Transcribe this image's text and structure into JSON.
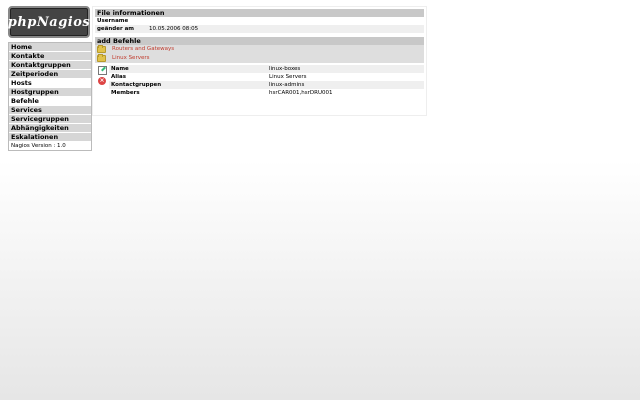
{
  "logo": {
    "text": "phpNagios"
  },
  "nav": {
    "items": [
      {
        "label": "Home"
      },
      {
        "label": "Kontakte"
      },
      {
        "label": "Kontaktgruppen"
      },
      {
        "label": "Zeitperioden"
      },
      {
        "label": "Hosts"
      },
      {
        "label": "Hostgruppen"
      },
      {
        "label": "Befehle"
      },
      {
        "label": "Services"
      },
      {
        "label": "Servicegruppen"
      },
      {
        "label": "Abhängigkeiten"
      },
      {
        "label": "Eskalationen"
      }
    ],
    "version": "Nagios Version : 1.0"
  },
  "file_info": {
    "header": "File informationen",
    "rows": [
      {
        "key": "Username",
        "value": ""
      },
      {
        "key": "geänder am",
        "value": "10.05.2006 08:05"
      }
    ]
  },
  "add": {
    "header": "add Befehle",
    "items": [
      {
        "label": "Routers and Gateways"
      },
      {
        "label": "Linux Servers"
      }
    ]
  },
  "details": {
    "rows": [
      {
        "key": "Name",
        "value": "linux-boxes"
      },
      {
        "key": "Alias",
        "value": "Linux Servers"
      },
      {
        "key": "Kontactgruppen",
        "value": "linux-admins"
      },
      {
        "key": "Members",
        "value": "hsrCAR001,hsrDRU001"
      }
    ]
  }
}
